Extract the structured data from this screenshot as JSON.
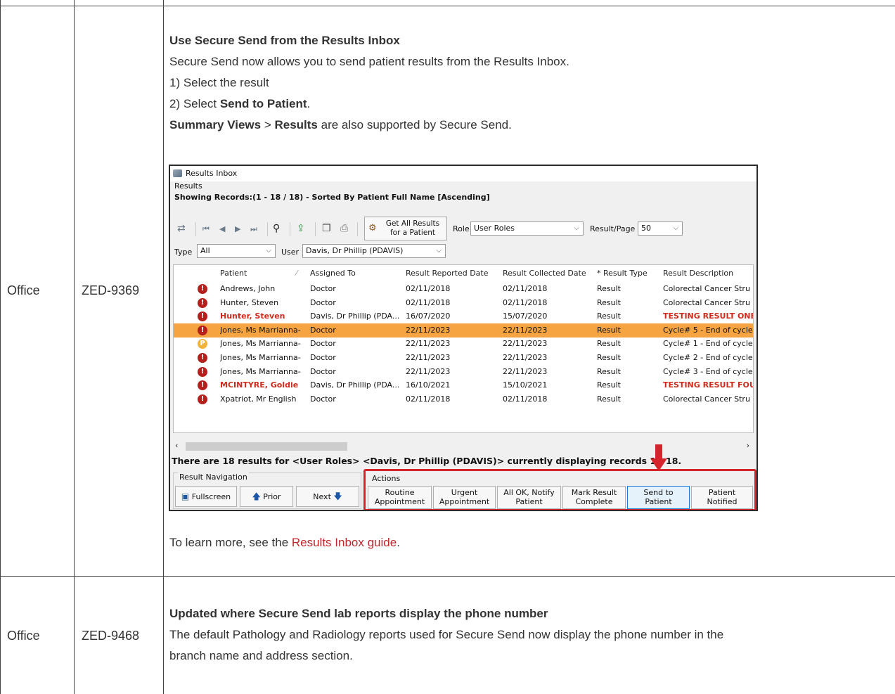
{
  "rows": [
    {
      "module": "Office",
      "id": "ZED-9369",
      "heading": "Use Secure Send from the Results Inbox",
      "intro": "Secure Send now allows you to send patient results from the Results Inbox.",
      "step1": "1) Select the result",
      "step2_prefix": "2) Select ",
      "step2_bold": "Send to Patient",
      "step2_suffix": ".",
      "summary_bold1": "Summary Views",
      "summary_sep": " > ",
      "summary_bold2": "Results",
      "summary_suffix": " are also supported by Secure Send.",
      "learn_prefix": "To learn more, see the ",
      "learn_link": "Results Inbox guide",
      "learn_suffix": "."
    },
    {
      "module": "Office",
      "id": "ZED-9468",
      "heading": "Updated where Secure Send lab reports display the phone number",
      "body_line1": "The default Pathology and Radiology reports used for Secure Send now display the phone number in the",
      "body_line2": "branch name and address section."
    }
  ],
  "screenshot": {
    "title": "Results Inbox",
    "group_label": "Results",
    "showing": "Showing Records:(1 - 18 / 18) - Sorted By Patient Full Name [Ascending]",
    "get_all_line1": "Get All Results",
    "get_all_line2": "for a Patient",
    "role_label": "Role",
    "role_value": "User Roles",
    "result_page_label": "Result/Page",
    "result_page_value": "50",
    "type_label": "Type",
    "type_value": "All",
    "user_label": "User",
    "user_value": "Davis, Dr Phillip (PDAVIS)",
    "columns": [
      "Patient",
      "Assigned To",
      "Result Reported Date",
      "Result Collected Date",
      "* Result Type",
      "Result Description"
    ],
    "results": [
      {
        "icon": "!",
        "patient": "Andrews, John",
        "assigned": "Doctor",
        "reported": "02/11/2018",
        "collected": "02/11/2018",
        "type": "Result",
        "desc": "Colorectal Cancer Stru",
        "red": false,
        "selected": false
      },
      {
        "icon": "!",
        "patient": "Hunter, Steven",
        "assigned": "Doctor",
        "reported": "02/11/2018",
        "collected": "02/11/2018",
        "type": "Result",
        "desc": "Colorectal Cancer Stru",
        "red": false,
        "selected": false
      },
      {
        "icon": "!",
        "patient": "Hunter, Steven",
        "assigned": "Davis, Dr Phillip (PDA...",
        "reported": "16/07/2020",
        "collected": "15/07/2020",
        "type": "Result",
        "desc": "TESTING RESULT ONE",
        "red": true,
        "selected": false
      },
      {
        "icon": "!",
        "patient": "Jones, Ms Marrianna-",
        "assigned": "Doctor",
        "reported": "22/11/2023",
        "collected": "22/11/2023",
        "type": "Result",
        "desc": "Cycle# 5 - End of cycle",
        "red": false,
        "selected": true
      },
      {
        "icon": "P",
        "patient": "Jones, Ms Marrianna-",
        "assigned": "Doctor",
        "reported": "22/11/2023",
        "collected": "22/11/2023",
        "type": "Result",
        "desc": "Cycle# 1 - End of cycle",
        "red": false,
        "selected": false
      },
      {
        "icon": "!",
        "patient": "Jones, Ms Marrianna-",
        "assigned": "Doctor",
        "reported": "22/11/2023",
        "collected": "22/11/2023",
        "type": "Result",
        "desc": "Cycle# 2 - End of cycle",
        "red": false,
        "selected": false
      },
      {
        "icon": "!",
        "patient": "Jones, Ms Marrianna-",
        "assigned": "Doctor",
        "reported": "22/11/2023",
        "collected": "22/11/2023",
        "type": "Result",
        "desc": "Cycle# 3 - End of cycle",
        "red": false,
        "selected": false
      },
      {
        "icon": "!",
        "patient": "MCINTYRE, Goldie",
        "assigned": "Davis, Dr Phillip (PDA...",
        "reported": "16/10/2021",
        "collected": "15/10/2021",
        "type": "Result",
        "desc": "TESTING RESULT FOUI",
        "red": true,
        "selected": false
      },
      {
        "icon": "!",
        "patient": "Xpatriot, Mr English",
        "assigned": "Doctor",
        "reported": "02/11/2018",
        "collected": "02/11/2018",
        "type": "Result",
        "desc": "Colorectal Cancer Stru",
        "red": false,
        "selected": false
      }
    ],
    "status_line": "There are 18 results for <User Roles> <Davis, Dr Phillip (PDAVIS)> currently displaying records 1 - 18.",
    "nav_label": "Result Navigation",
    "fullscreen": "Fullscreen",
    "prior": "Prior",
    "next": "Next",
    "actions_label": "Actions",
    "actions": [
      {
        "l1": "Routine",
        "l2": "Appointment"
      },
      {
        "l1": "Urgent",
        "l2": "Appointment"
      },
      {
        "l1": "All OK, Notify",
        "l2": "Patient"
      },
      {
        "l1": "Mark Result",
        "l2": "Complete"
      },
      {
        "l1": "Send to",
        "l2": "Patient"
      },
      {
        "l1": "Patient",
        "l2": "Notified"
      }
    ],
    "colors": {
      "selected_row": "#f6a341",
      "highlight": "#d6242e",
      "link": "#c0272d"
    }
  }
}
